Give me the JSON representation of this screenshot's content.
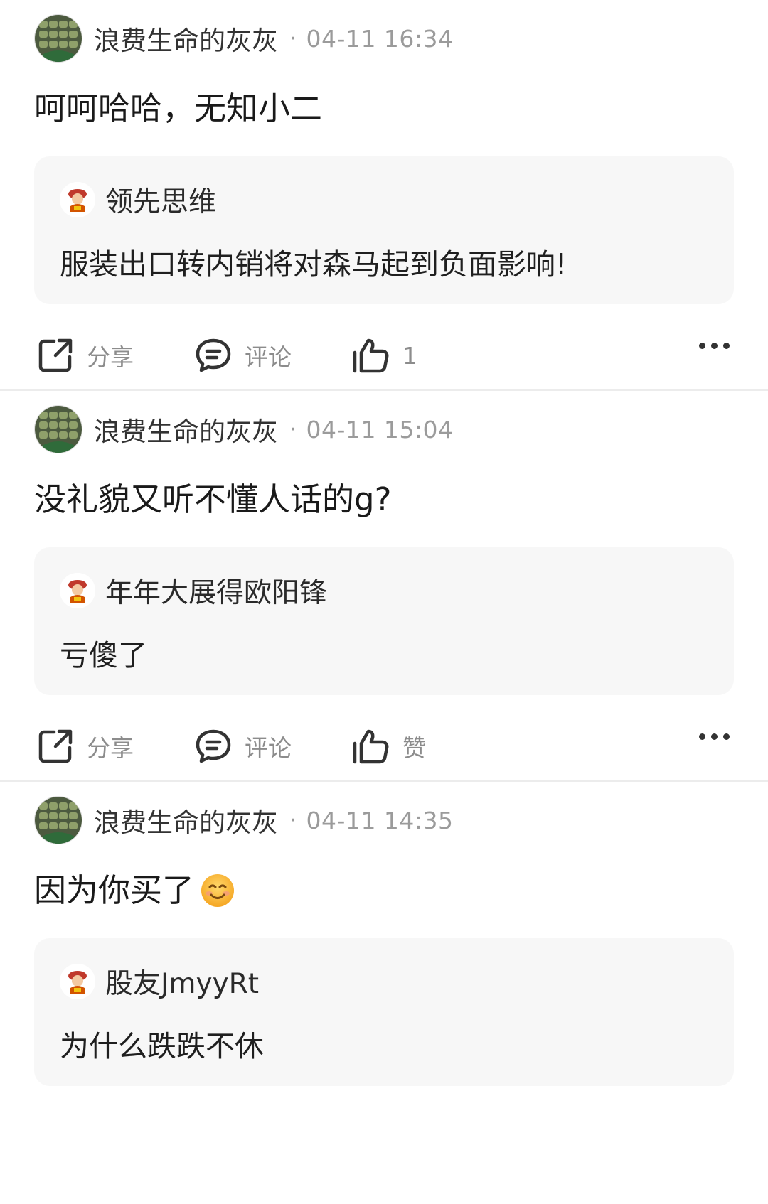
{
  "posts": [
    {
      "author": "浪费生命的灰灰",
      "separator": "·",
      "time": "04-11 16:34",
      "text": "呵呵哈哈，无知小二",
      "quote": {
        "user": "领先思维",
        "text": "服装出口转内销将对森马起到负面影响!"
      },
      "actions": {
        "share": "分享",
        "comment": "评论",
        "like": "1"
      }
    },
    {
      "author": "浪费生命的灰灰",
      "separator": "·",
      "time": "04-11 15:04",
      "text": "没礼貌又听不懂人话的g?",
      "quote": {
        "user": "年年大展得欧阳锋",
        "text": "亏傻了"
      },
      "actions": {
        "share": "分享",
        "comment": "评论",
        "like": "赞"
      }
    },
    {
      "author": "浪费生命的灰灰",
      "separator": "·",
      "time": "04-11 14:35",
      "text": "因为你买了",
      "quote": {
        "user": "股友JmyyRt",
        "text": "为什么跌跌不休"
      }
    }
  ],
  "colors": {
    "accent_text": "#1f1f1f",
    "muted": "#9b9b9b",
    "quote_bg": "#f7f7f7"
  }
}
